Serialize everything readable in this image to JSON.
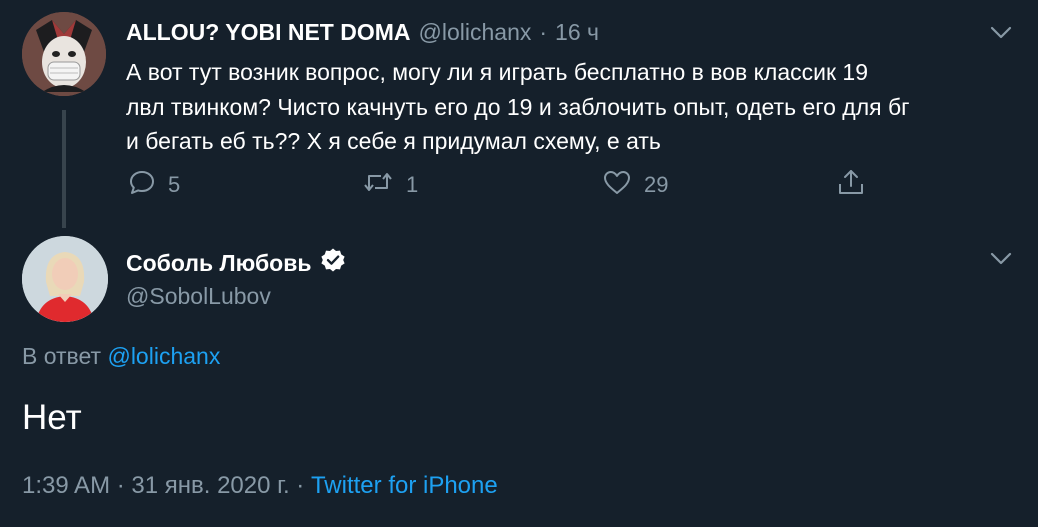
{
  "tweet1": {
    "name": "ALLOU? YOBI NET DOMA",
    "handle": "@lolichanx",
    "separator": "·",
    "time": "16 ч",
    "text_lines": [
      "А вот тут возник вопрос, могу ли я играть бесплатно в вов классик 19",
      "лвл твинком? Чисто качнуть его до 19 и заблочить опыт, одеть его для бг",
      "и бегать еб      ть?? Х  я себе я придумал схему, е   ать"
    ],
    "replies": "5",
    "retweets": "1",
    "likes": "29"
  },
  "tweet2": {
    "name": "Соболь Любовь",
    "handle": "@SobolLubov",
    "reply_prefix": "В ответ",
    "reply_handle": "@lolichanx",
    "text": "Нет",
    "timestamp": "1:39 AM · 31 янв. 2020 г. ·",
    "source": "Twitter for iPhone"
  },
  "colors": {
    "background": "#15202b",
    "muted": "#8899a6",
    "link": "#1da1f2",
    "divider": "#38444d"
  },
  "icons": [
    "chevron-down-icon",
    "reply-icon",
    "retweet-icon",
    "like-icon",
    "share-icon",
    "verified-badge-icon"
  ]
}
